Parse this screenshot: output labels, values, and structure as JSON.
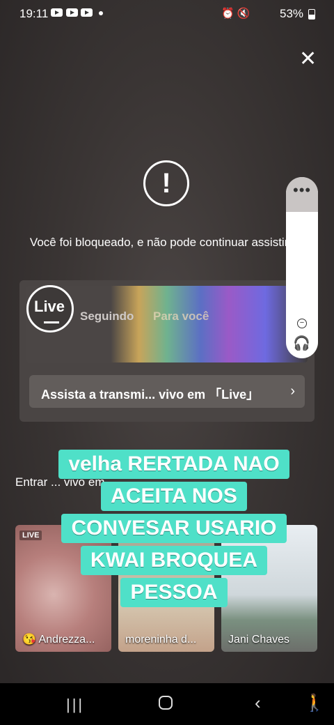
{
  "status_bar": {
    "time": "19:11",
    "system_icons": "⏰🔇",
    "battery": "53%"
  },
  "blocked_message": "Você foi bloqueado, e não pode continuar assistindo",
  "live_card": {
    "logo": "Live",
    "tab_following": "Seguindo",
    "tab_for_you": "Para você",
    "cta_label": "Assista a transmi... vivo em 「Live」",
    "cta_chevron": "›"
  },
  "section_text": "Entrar ... vivo em...",
  "streams": [
    {
      "badge": "LIVE",
      "name": "😘 Andrezza..."
    },
    {
      "badge": "",
      "name": "moreninha d..."
    },
    {
      "badge": "",
      "name": "Jani Chaves"
    }
  ],
  "overlay_caption": [
    "velha RERTADA  NAO",
    "ACEITA NOS",
    "CONVESAR USARIO",
    "KWAI  BROQUEA",
    "PESSOA"
  ],
  "icons": {
    "close": "close-icon",
    "alert": "exclamation-icon",
    "volume_more": "more-icon",
    "earbuds": "earbuds-icon"
  },
  "colors": {
    "overlay_bg": "#4fe0c8",
    "background": "#3a3534"
  }
}
